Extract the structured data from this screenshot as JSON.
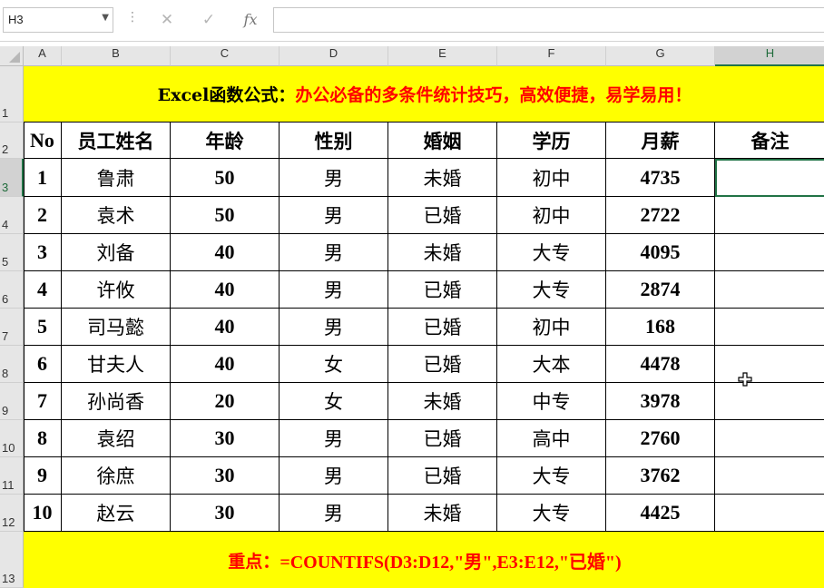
{
  "formula_bar": {
    "name_box": "H3",
    "cancel_icon": "close-icon",
    "enter_icon": "check-icon",
    "fx_label": "fx",
    "formula": ""
  },
  "sheet": {
    "columns": [
      "A",
      "B",
      "C",
      "D",
      "E",
      "F",
      "G",
      "H"
    ],
    "rows": [
      "1",
      "2",
      "3",
      "4",
      "5",
      "6",
      "7",
      "8",
      "9",
      "10",
      "11",
      "12",
      "13"
    ],
    "selected_cell": "H3",
    "title": {
      "prefix": "Excel函数公式：",
      "main": "办公必备的多条件统计技巧，高效便捷，易学易用！"
    },
    "headers": [
      "No",
      "员工姓名",
      "年龄",
      "性别",
      "婚姻",
      "学历",
      "月薪",
      "备注"
    ],
    "data": [
      [
        "1",
        "鲁肃",
        "50",
        "男",
        "未婚",
        "初中",
        "4735",
        ""
      ],
      [
        "2",
        "袁术",
        "50",
        "男",
        "已婚",
        "初中",
        "2722",
        ""
      ],
      [
        "3",
        "刘备",
        "40",
        "男",
        "未婚",
        "大专",
        "4095",
        ""
      ],
      [
        "4",
        "许攸",
        "40",
        "男",
        "已婚",
        "大专",
        "2874",
        ""
      ],
      [
        "5",
        "司马懿",
        "40",
        "男",
        "已婚",
        "初中",
        "168",
        ""
      ],
      [
        "6",
        "甘夫人",
        "40",
        "女",
        "已婚",
        "大本",
        "4478",
        ""
      ],
      [
        "7",
        "孙尚香",
        "20",
        "女",
        "未婚",
        "中专",
        "3978",
        ""
      ],
      [
        "8",
        "袁绍",
        "30",
        "男",
        "已婚",
        "高中",
        "2760",
        ""
      ],
      [
        "9",
        "徐庶",
        "30",
        "男",
        "已婚",
        "大专",
        "3762",
        ""
      ],
      [
        "10",
        "赵云",
        "30",
        "男",
        "未婚",
        "大专",
        "4425",
        ""
      ]
    ],
    "footer": {
      "prefix": "重点：",
      "formula": "=COUNTIFS(D3:D12,\"男\",E3:E12,\"已婚\")"
    }
  },
  "colors": {
    "banner": "#ffff00",
    "highlight_text": "#ff0000",
    "selection": "#217346"
  }
}
